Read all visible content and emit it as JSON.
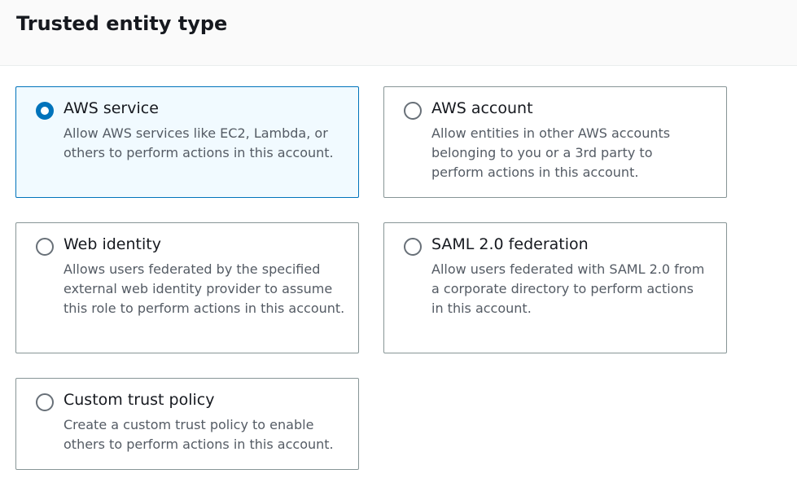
{
  "header": {
    "title": "Trusted entity type"
  },
  "options": [
    {
      "label": "AWS service",
      "description": "Allow AWS services like EC2, Lambda, or others to perform actions in this account.",
      "selected": true
    },
    {
      "label": "AWS account",
      "description": "Allow entities in other AWS accounts belonging to you or a 3rd party to perform actions in this account.",
      "selected": false
    },
    {
      "label": "Web identity",
      "description": "Allows users federated by the specified external web identity provider to assume this role to perform actions in this account.",
      "selected": false
    },
    {
      "label": "SAML 2.0 federation",
      "description": "Allow users federated with SAML 2.0 from a corporate directory to perform actions in this account.",
      "selected": false
    },
    {
      "label": "Custom trust policy",
      "description": "Create a custom trust policy to enable others to perform actions in this account.",
      "selected": false
    }
  ],
  "colors": {
    "accent": "#0073bb",
    "selected_background": "#f1faff",
    "border": "#879596",
    "header_background": "#fafafa",
    "text": "#16191f",
    "description_text": "#545b64"
  }
}
